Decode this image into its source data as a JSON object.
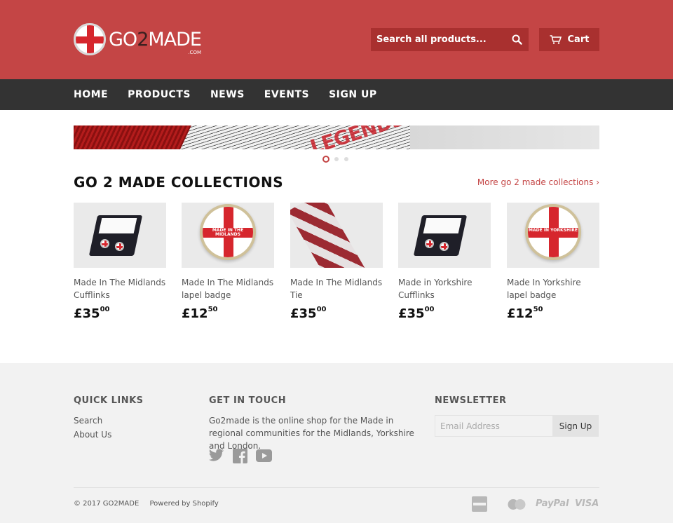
{
  "header": {
    "logo": {
      "text_main": "GO",
      "text_two": "2",
      "text_end": "MADE",
      "dotcom": ".COM"
    },
    "search": {
      "placeholder": "Search all products...",
      "icon": "search-icon"
    },
    "cart": {
      "label": "Cart",
      "icon": "cart-icon"
    },
    "colors": {
      "primary": "#c44545",
      "primary_dark": "#a9302f"
    }
  },
  "nav": {
    "items": [
      {
        "label": "HOME"
      },
      {
        "label": "PRODUCTS"
      },
      {
        "label": "NEWS"
      },
      {
        "label": "EVENTS"
      },
      {
        "label": "SIGN UP"
      }
    ],
    "background": "#333333"
  },
  "slider": {
    "banner_text": "LEGENDS",
    "slides": 3,
    "active_slide": 1
  },
  "collections": {
    "title": "GO 2 MADE COLLECTIONS",
    "more_link": "More go 2 made collections ›",
    "products": [
      {
        "title": "Made In The Midlands Cufflinks",
        "price_main": "£35",
        "price_cents": "00",
        "image": "cufflinks-image"
      },
      {
        "title": "Made In The Midlands lapel badge",
        "price_main": "£12",
        "price_cents": "50",
        "image": "badge-image",
        "badge_text": "MADE IN THE MIDLANDS"
      },
      {
        "title": "Made In The Midlands Tie",
        "price_main": "£35",
        "price_cents": "00",
        "image": "tie-image"
      },
      {
        "title": "Made in Yorkshire Cufflinks",
        "price_main": "£35",
        "price_cents": "00",
        "image": "cufflinks-image"
      },
      {
        "title": "Made In Yorkshire lapel badge",
        "price_main": "£12",
        "price_cents": "50",
        "image": "badge-image",
        "badge_text": "MADE IN YORKSHIRE"
      }
    ]
  },
  "footer": {
    "quick_links": {
      "title": "QUICK LINKS",
      "links": [
        "Search",
        "About Us"
      ]
    },
    "get_in_touch": {
      "title": "GET IN TOUCH",
      "text": "Go2made is the online shop for the Made in regional communities for the Midlands, Yorkshire and London.",
      "social_icons": [
        "twitter-icon",
        "facebook-icon",
        "youtube-icon"
      ]
    },
    "newsletter": {
      "title": "NEWSLETTER",
      "placeholder": "Email Address",
      "button": "Sign Up"
    },
    "copyright": "© 2017 GO2MADE",
    "powered_by": "Powered by Shopify",
    "payment_icons": [
      "american-express-icon",
      "mastercard-icon",
      "paypal-icon",
      "visa-icon"
    ],
    "payment_labels": {
      "paypal": "PayPal",
      "visa": "VISA"
    }
  }
}
